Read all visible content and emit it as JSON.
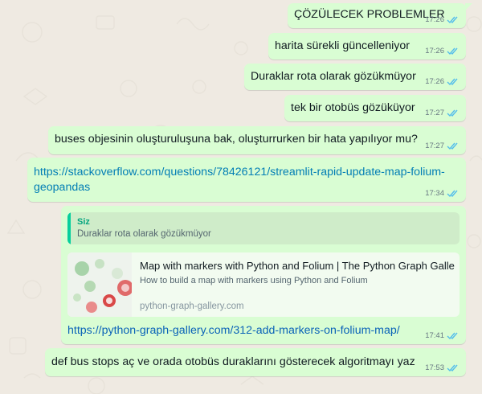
{
  "chat": {
    "messages": [
      {
        "text": "ÇÖZÜLECEK PROBLEMLER",
        "time": "17:26"
      },
      {
        "text": "harita sürekli güncelleniyor",
        "time": "17:26"
      },
      {
        "text": "Duraklar rota olarak gözükmüyor",
        "time": "17:26"
      },
      {
        "text": "tek bir otobüs gözüküyor",
        "time": "17:27"
      },
      {
        "text": "buses objesinin oluşturuluşuna bak, oluşturrurken bir hata yapılıyor mu?",
        "time": "17:27"
      },
      {
        "line1": "https://stackoverflow.com/questions/78426121/streamlit-rapid-update-map-folium-",
        "line2": "geopandas",
        "time": "17:34"
      },
      {
        "quote": {
          "author": "Siz",
          "text": "Duraklar rota olarak gözükmüyor"
        },
        "preview": {
          "title": "Map with markers with Python and Folium | The Python Graph Gallery",
          "description": "How to build a map with markers using Python and Folium",
          "site": "python-graph-gallery.com"
        },
        "link": "https://python-graph-gallery.com/312-add-markers-on-folium-map/",
        "time": "17:41"
      },
      {
        "text": "def bus stops aç ve orada otobüs duraklarını gösterecek algoritmayı yaz",
        "time": "17:53"
      }
    ]
  },
  "colors": {
    "bubble": "#d9fdd3",
    "background": "#efeae2",
    "read_tick": "#53bdeb",
    "link": "#027eb5",
    "quote_accent": "#06cf9c"
  }
}
